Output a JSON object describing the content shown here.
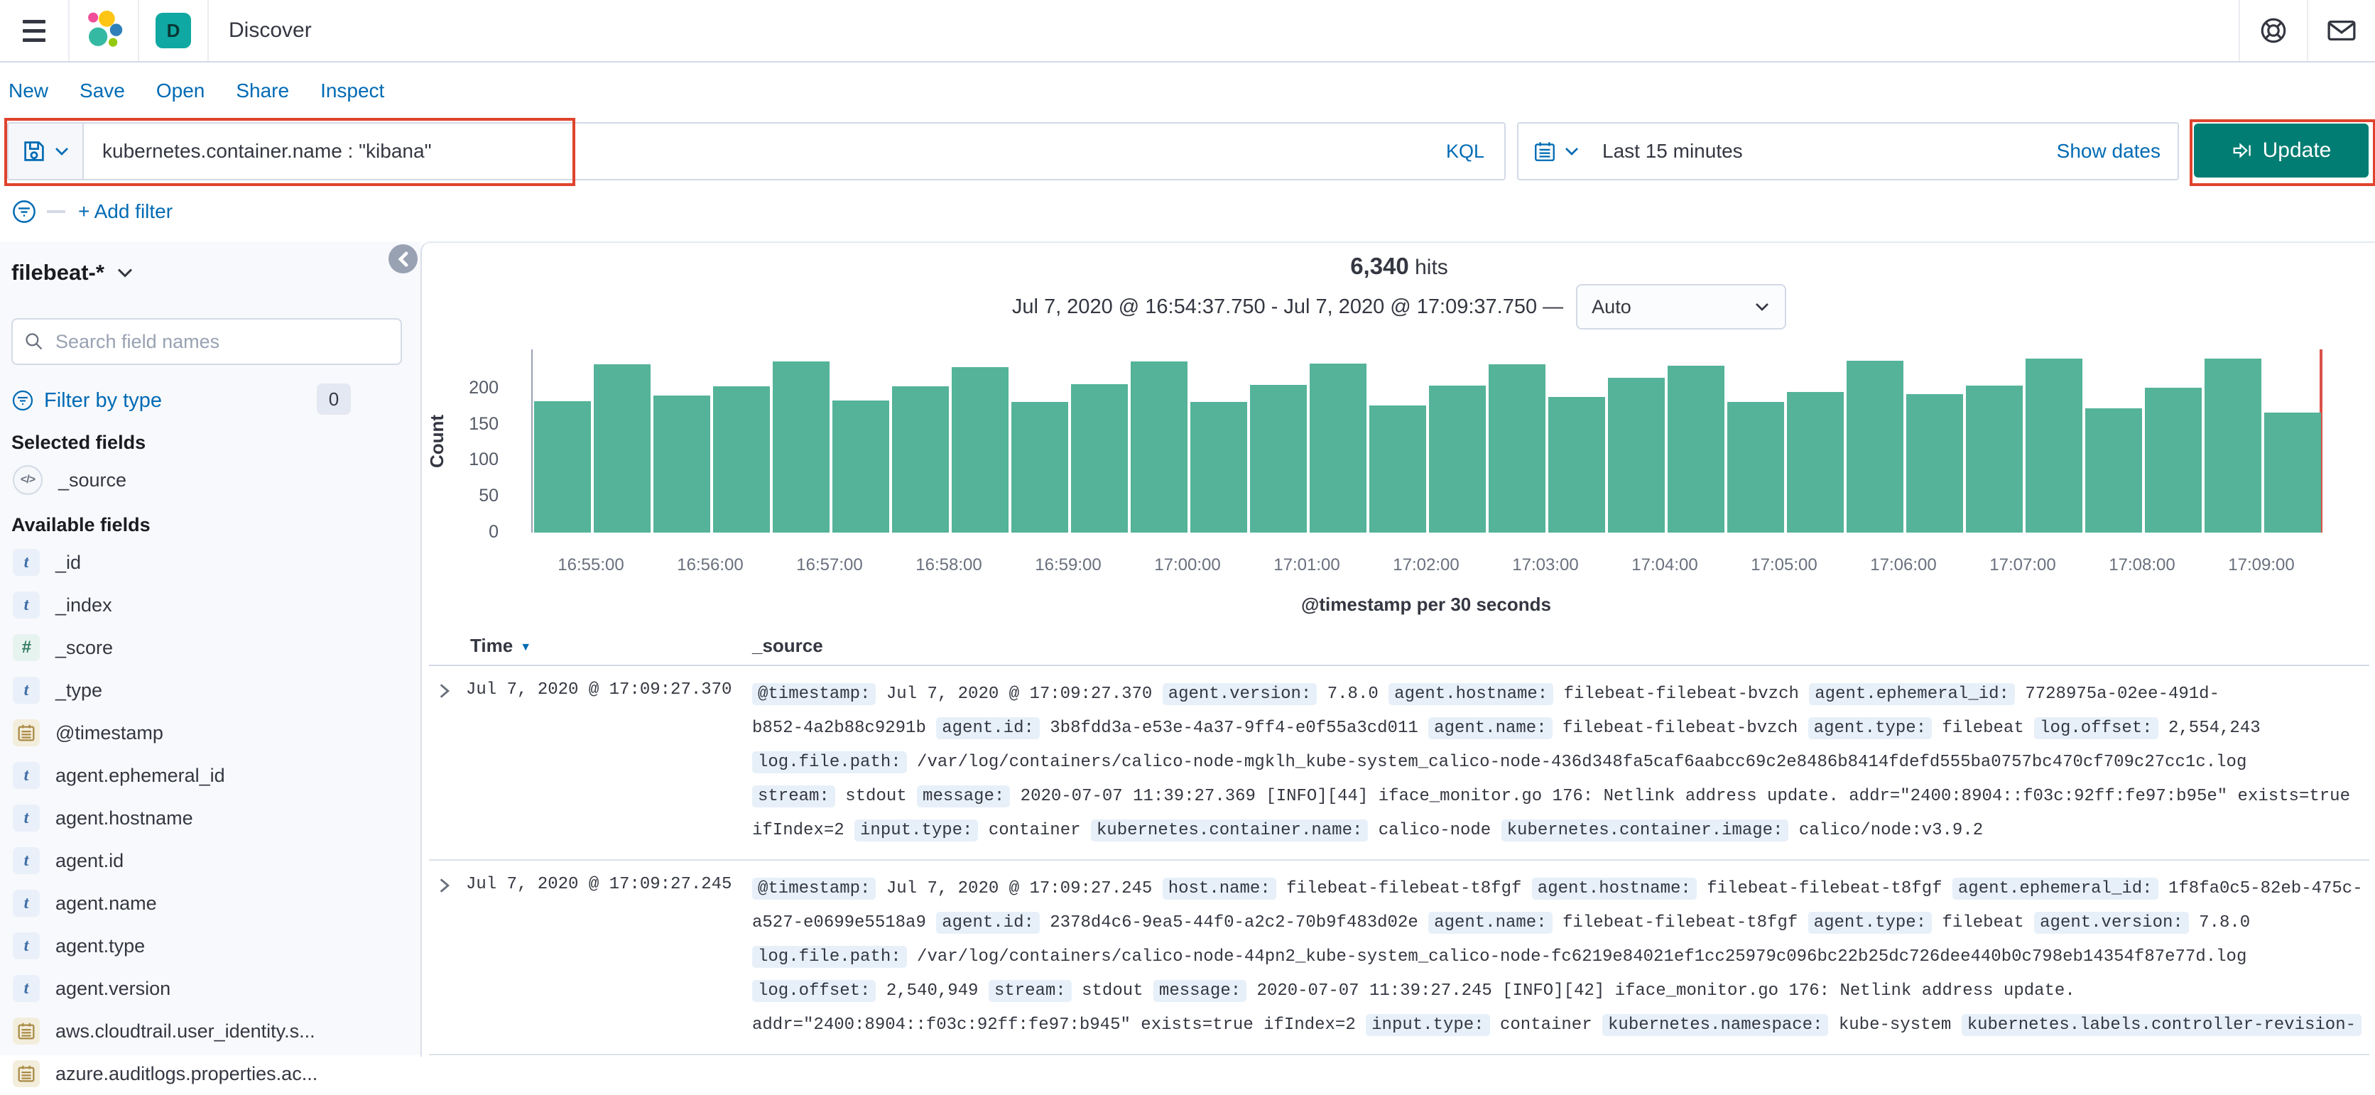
{
  "colors": {
    "link_blue": "#006bb4",
    "text": "#343741",
    "subdued": "#69707d",
    "border": "#d3dae6",
    "bar_teal": "#54b399",
    "update_fill": "#017d73",
    "annotation_red": "#e0432d",
    "time_marker_red": "#db5149",
    "space_badge_teal": "#10a8a2",
    "pill_bg": "#e7f0f9"
  },
  "topnav": {
    "space_initial": "D",
    "app_title": "Discover",
    "icons": [
      "menu-icon",
      "elastic-logo",
      "help-icon",
      "mail-icon"
    ]
  },
  "toolbar": {
    "items": [
      "New",
      "Save",
      "Open",
      "Share",
      "Inspect"
    ]
  },
  "query_bar": {
    "query": "kubernetes.container.name : \"kibana\"",
    "language_label": "KQL",
    "time_range": "Last 15 minutes",
    "show_dates_label": "Show dates",
    "update_label": "Update"
  },
  "filter_bar": {
    "add_filter_label": "+ Add filter"
  },
  "sidebar": {
    "index_pattern": "filebeat-*",
    "search_placeholder": "Search field names",
    "filter_by_type_label": "Filter by type",
    "filter_count": "0",
    "selected_heading": "Selected fields",
    "selected_fields": [
      {
        "name": "_source",
        "type": "source"
      }
    ],
    "available_heading": "Available fields",
    "available_fields": [
      {
        "name": "_id",
        "type": "string"
      },
      {
        "name": "_index",
        "type": "string"
      },
      {
        "name": "_score",
        "type": "number"
      },
      {
        "name": "_type",
        "type": "string"
      },
      {
        "name": "@timestamp",
        "type": "date"
      },
      {
        "name": "agent.ephemeral_id",
        "type": "string"
      },
      {
        "name": "agent.hostname",
        "type": "string"
      },
      {
        "name": "agent.id",
        "type": "string"
      },
      {
        "name": "agent.name",
        "type": "string"
      },
      {
        "name": "agent.type",
        "type": "string"
      },
      {
        "name": "agent.version",
        "type": "string"
      },
      {
        "name": "aws.cloudtrail.user_identity.s...",
        "type": "date"
      },
      {
        "name": "azure.auditlogs.properties.ac...",
        "type": "date"
      }
    ]
  },
  "chart_data": {
    "type": "bar",
    "hits_count": "6,340",
    "hits_label": "hits",
    "range_label": "Jul 7, 2020 @ 16:54:37.750 - Jul 7, 2020 @ 17:09:37.750 —",
    "interval_label": "Auto",
    "ylabel": "Count",
    "xlabel": "@timestamp per 30 seconds",
    "yticks": [
      0,
      50,
      100,
      150,
      200
    ],
    "ylim": [
      0,
      254
    ],
    "x_start": "16:54:30",
    "x_interval_seconds": 30,
    "x_tick_labels": [
      "16:55:00",
      "16:56:00",
      "16:57:00",
      "16:58:00",
      "16:59:00",
      "17:00:00",
      "17:01:00",
      "17:02:00",
      "17:03:00",
      "17:04:00",
      "17:05:00",
      "17:06:00",
      "17:07:00",
      "17:08:00",
      "17:09:00"
    ],
    "values": [
      182,
      233,
      190,
      203,
      237,
      183,
      203,
      229,
      181,
      206,
      237,
      181,
      205,
      234,
      176,
      204,
      233,
      188,
      215,
      231,
      181,
      195,
      238,
      192,
      204,
      241,
      172,
      201,
      241,
      166
    ],
    "grid": false,
    "legend": false,
    "bar_color": "#54b399",
    "time_marker_color": "#db5149"
  },
  "table": {
    "time_header": "Time",
    "source_header": "_source",
    "rows": [
      {
        "time": "Jul 7, 2020 @ 17:09:27.370",
        "lines": [
          [
            [
              "f",
              "@timestamp:"
            ],
            [
              "t",
              " Jul 7, 2020 @ 17:09:27.370 "
            ],
            [
              "f",
              "agent.version:"
            ],
            [
              "t",
              " 7.8.0 "
            ],
            [
              "f",
              "agent.hostname:"
            ],
            [
              "t",
              " filebeat-filebeat-bvzch "
            ],
            [
              "f",
              "agent.ephemeral_id:"
            ],
            [
              "t",
              " 7728975a-02ee-491d-"
            ]
          ],
          [
            [
              "t",
              "b852-4a2b88c9291b "
            ],
            [
              "f",
              "agent.id:"
            ],
            [
              "t",
              " 3b8fdd3a-e53e-4a37-9ff4-e0f55a3cd011 "
            ],
            [
              "f",
              "agent.name:"
            ],
            [
              "t",
              " filebeat-filebeat-bvzch "
            ],
            [
              "f",
              "agent.type:"
            ],
            [
              "t",
              " filebeat "
            ],
            [
              "f",
              "log.offset:"
            ],
            [
              "t",
              " 2,554,243"
            ]
          ],
          [
            [
              "f",
              "log.file.path:"
            ],
            [
              "t",
              " /var/log/containers/calico-node-mgklh_kube-system_calico-node-436d348fa5caf6aabcc69c2e8486b8414fdefd555ba0757bc470cf709c27cc1c.log"
            ]
          ],
          [
            [
              "f",
              "stream:"
            ],
            [
              "t",
              " stdout "
            ],
            [
              "f",
              "message:"
            ],
            [
              "t",
              " 2020-07-07 11:39:27.369 [INFO][44] iface_monitor.go 176: Netlink address update. addr=\"2400:8904::f03c:92ff:fe97:b95e\" exists=true"
            ]
          ],
          [
            [
              "t",
              "ifIndex=2 "
            ],
            [
              "f",
              "input.type:"
            ],
            [
              "t",
              " container "
            ],
            [
              "f",
              "kubernetes.container.name:"
            ],
            [
              "t",
              " calico-node "
            ],
            [
              "f",
              "kubernetes.container.image:"
            ],
            [
              "t",
              " calico/node:v3.9.2"
            ]
          ]
        ]
      },
      {
        "time": "Jul 7, 2020 @ 17:09:27.245",
        "lines": [
          [
            [
              "f",
              "@timestamp:"
            ],
            [
              "t",
              " Jul 7, 2020 @ 17:09:27.245 "
            ],
            [
              "f",
              "host.name:"
            ],
            [
              "t",
              " filebeat-filebeat-t8fgf "
            ],
            [
              "f",
              "agent.hostname:"
            ],
            [
              "t",
              " filebeat-filebeat-t8fgf "
            ],
            [
              "f",
              "agent.ephemeral_id:"
            ],
            [
              "t",
              " 1f8fa0c5-82eb-475c-"
            ]
          ],
          [
            [
              "t",
              "a527-e0699e5518a9 "
            ],
            [
              "f",
              "agent.id:"
            ],
            [
              "t",
              " 2378d4c6-9ea5-44f0-a2c2-70b9f483d02e "
            ],
            [
              "f",
              "agent.name:"
            ],
            [
              "t",
              " filebeat-filebeat-t8fgf "
            ],
            [
              "f",
              "agent.type:"
            ],
            [
              "t",
              " filebeat "
            ],
            [
              "f",
              "agent.version:"
            ],
            [
              "t",
              " 7.8.0"
            ]
          ],
          [
            [
              "f",
              "log.file.path:"
            ],
            [
              "t",
              " /var/log/containers/calico-node-44pn2_kube-system_calico-node-fc6219e84021ef1cc25979c096bc22b25dc726dee440b0c798eb14354f87e77d.log"
            ]
          ],
          [
            [
              "f",
              "log.offset:"
            ],
            [
              "t",
              " 2,540,949 "
            ],
            [
              "f",
              "stream:"
            ],
            [
              "t",
              " stdout "
            ],
            [
              "f",
              "message:"
            ],
            [
              "t",
              " 2020-07-07 11:39:27.245 [INFO][42] iface_monitor.go 176: Netlink address update."
            ]
          ],
          [
            [
              "t",
              "addr=\"2400:8904::f03c:92ff:fe97:b945\" exists=true ifIndex=2 "
            ],
            [
              "f",
              "input.type:"
            ],
            [
              "t",
              " container "
            ],
            [
              "f",
              "kubernetes.namespace:"
            ],
            [
              "t",
              " kube-system "
            ],
            [
              "f",
              "kubernetes.labels.controller-revision-"
            ]
          ]
        ]
      }
    ]
  }
}
